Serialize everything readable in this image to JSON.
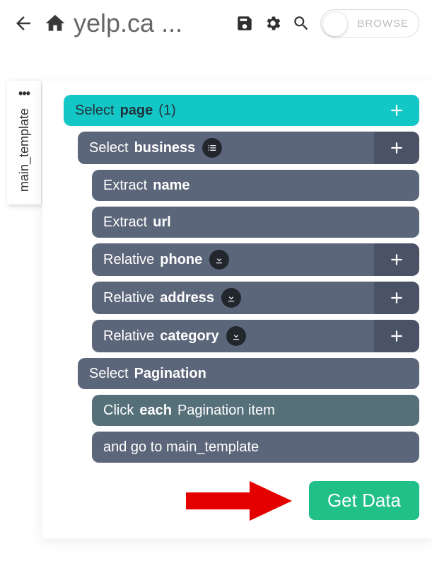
{
  "header": {
    "title": "yelp.ca ...",
    "toggle_label": "BROWSE"
  },
  "tab": {
    "label": "main_template",
    "dots": "•••"
  },
  "commands": {
    "select_page": {
      "kw": "Select",
      "target": "page",
      "count": "(1)"
    },
    "select_business": {
      "kw": "Select",
      "target": "business"
    },
    "extract_name": {
      "kw": "Extract",
      "target": "name"
    },
    "extract_url": {
      "kw": "Extract",
      "target": "url"
    },
    "rel_phone": {
      "kw": "Relative",
      "target": "phone"
    },
    "rel_address": {
      "kw": "Relative",
      "target": "address"
    },
    "rel_category": {
      "kw": "Relative",
      "target": "category"
    },
    "select_pagination": {
      "kw": "Select",
      "target": "Pagination"
    },
    "click_each": {
      "pre": "Click",
      "bold": "each",
      "post": "Pagination item"
    },
    "goto": {
      "text": "and go to main_template"
    }
  },
  "footer": {
    "get_data": "Get Data"
  }
}
